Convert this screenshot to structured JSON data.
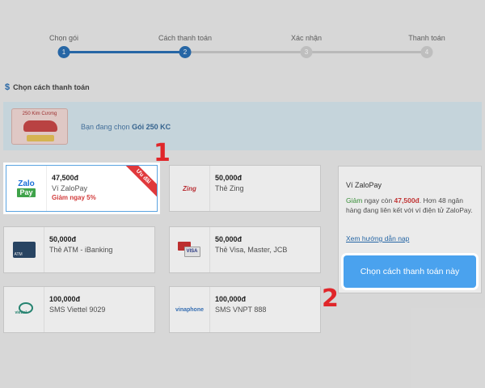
{
  "stepper": {
    "steps": [
      {
        "label": "Chọn gói",
        "number": "1"
      },
      {
        "label": "Cách thanh toán",
        "number": "2"
      },
      {
        "label": "Xác nhận",
        "number": "3"
      },
      {
        "label": "Thanh toán",
        "number": "4"
      }
    ],
    "current_step": 2
  },
  "section": {
    "title": "Chọn cách thanh toán",
    "icon": "dollar-icon"
  },
  "banner": {
    "package_image_text": "250 Kim Cương",
    "prefix": "Bạn đang chọn",
    "package_name": "Gói 250 KC"
  },
  "payment_methods": [
    {
      "price": "47,500đ",
      "name": "Ví ZaloPay",
      "discount": "Giảm ngay 5%",
      "ribbon": "Ưu đãi",
      "logo": "zalopay-logo",
      "logo_top": "Zalo",
      "logo_bottom": "Pay",
      "selected": true
    },
    {
      "price": "50,000đ",
      "name": "Thẻ Zing",
      "logo": "zing-logo",
      "logo_text": "Zing"
    },
    {
      "price": "50,000đ",
      "name": "Thẻ ATM - iBanking",
      "logo": "atm-card-icon"
    },
    {
      "price": "50,000đ",
      "name": "Thẻ Visa, Master, JCB",
      "logo": "visa-card-icon"
    },
    {
      "price": "100,000đ",
      "name": "SMS Viettel 9029",
      "logo": "viettel-logo"
    },
    {
      "price": "100,000đ",
      "name": "SMS VNPT 888",
      "logo": "vinaphone-logo",
      "logo_text": "vinaphone"
    }
  ],
  "info_panel": {
    "title": "Ví ZaloPay",
    "desc_green": "Giảm",
    "desc_mid": " ngay còn ",
    "desc_price": "47,500đ",
    "desc_rest": ". Hơn 48 ngân hàng đang liên kết với ví điện tử ZaloPay.",
    "guide_link": "Xem hướng dẫn nạp"
  },
  "pay_button": {
    "label": "Chọn cách thanh toán này"
  },
  "annotations": {
    "one": "1",
    "two": "2"
  },
  "colors": {
    "accent": "#2a6fb3",
    "button": "#4aa2ee",
    "discount": "#d23b3b",
    "annotation": "#e0262a"
  }
}
